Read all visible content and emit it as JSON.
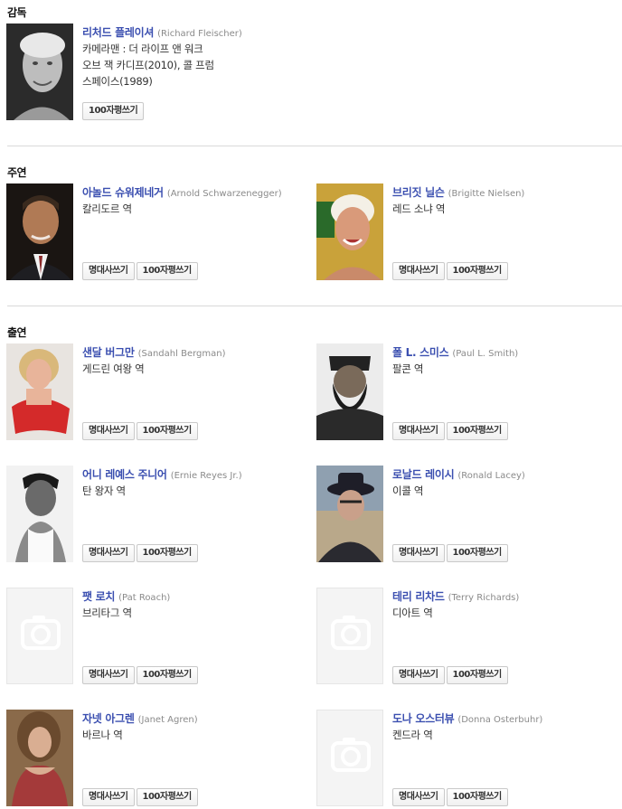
{
  "sections": {
    "director": "감독",
    "lead": "주연",
    "supporting": "출연"
  },
  "buttons": {
    "quote": "명대사쓰기",
    "review": "100자평쓰기"
  },
  "director": {
    "name": "리처드 플레이셔",
    "en_name": "(Richard Fleischer)",
    "works_line1": "카메라맨 : 더 라이프 앤 워크",
    "works_line2": "오브 잭 카디프(2010), 콜 프럼",
    "works_line3": "스페이스(1989)"
  },
  "lead": [
    {
      "name": "아놀드 슈워제네거",
      "en_name": "(Arnold Schwarzenegger)",
      "role": "칼리도르 역"
    },
    {
      "name": "브리짓 닐슨",
      "en_name": "(Brigitte Nielsen)",
      "role": "레드 소냐 역"
    }
  ],
  "cast": [
    {
      "name": "샌달 버그만",
      "en_name": "(Sandahl Bergman)",
      "role": "게드린 여왕 역"
    },
    {
      "name": "폴 L. 스미스",
      "en_name": "(Paul L. Smith)",
      "role": "팔콘 역"
    },
    {
      "name": "어니 레예스 주니어",
      "en_name": "(Ernie Reyes Jr.)",
      "role": "탄 왕자 역"
    },
    {
      "name": "로날드 레이시",
      "en_name": "(Ronald Lacey)",
      "role": "이콜 역"
    },
    {
      "name": "팻 로치",
      "en_name": "(Pat Roach)",
      "role": "브리타그 역"
    },
    {
      "name": "테리 리차드",
      "en_name": "(Terry Richards)",
      "role": "디아트 역"
    },
    {
      "name": "자넷 아그렌",
      "en_name": "(Janet Agren)",
      "role": "바르나 역"
    },
    {
      "name": "도나 오스터뷰",
      "en_name": "(Donna Osterbuhr)",
      "role": "켄드라 역"
    }
  ]
}
